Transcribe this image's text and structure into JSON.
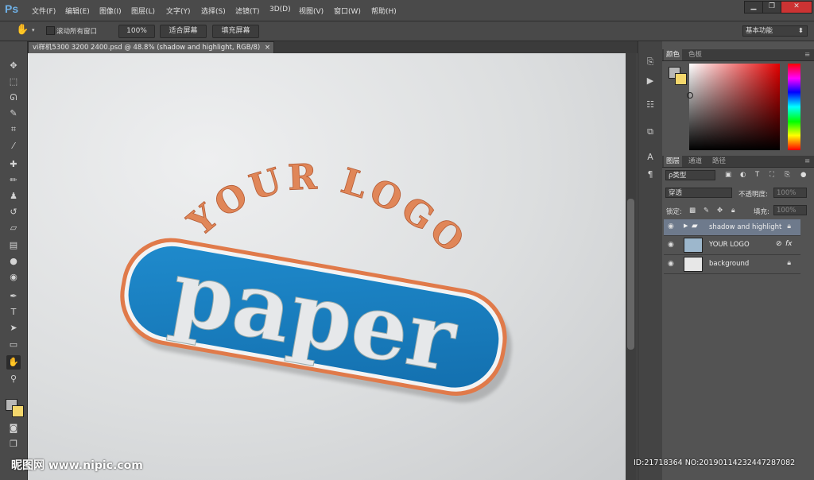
{
  "app": {
    "logo": "Ps"
  },
  "menu": [
    "文件(F)",
    "编辑(E)",
    "图像(I)",
    "图层(L)",
    "文字(Y)",
    "选择(S)",
    "滤镜(T)",
    "3D(D)",
    "视图(V)",
    "窗口(W)",
    "帮助(H)"
  ],
  "window_controls": {
    "minimize": "▁",
    "restore": "❐",
    "close": "✕"
  },
  "options_bar": {
    "scroll_all_label": "滚动所有窗口",
    "btn_100": "100%",
    "btn_fit": "适合屏幕",
    "btn_fill": "填充屏幕",
    "workspace": "基本功能"
  },
  "document": {
    "tab_title": "vi样机5300 3200 2400.psd @ 48.8% (shadow and highlight, RGB/8)",
    "tab_close": "×"
  },
  "artwork": {
    "arc_text": "YOUR LOGO",
    "main_text": "paper",
    "colors": {
      "badge_blue": "#2287c4",
      "badge_border": "#e07a4a",
      "arc_text": "#e08658",
      "paper_text": "#e6e8ea"
    }
  },
  "color_panel": {
    "tabs": [
      "颜色",
      "色板"
    ],
    "fg_color": "#b8b8b8",
    "bg_color": "#f4d76c"
  },
  "layers_panel": {
    "tabs": [
      "图层",
      "通道",
      "路径"
    ],
    "filter_kind": "ρ类型",
    "blend_mode": "穿透",
    "opacity_label": "不透明度:",
    "opacity_value": "100%",
    "lock_label": "锁定:",
    "fill_label": "填充:",
    "fill_value": "100%",
    "layers": [
      {
        "name": "shadow and highlight",
        "type": "group",
        "selected": true
      },
      {
        "name": "YOUR LOGO",
        "type": "smart",
        "fx": "fx",
        "selected": false
      },
      {
        "name": "background",
        "type": "pixel",
        "selected": false
      }
    ]
  },
  "watermark": {
    "site": "昵图网 www.nipic.com",
    "id_text": "ID:21718364 NO:20190114232447287082"
  }
}
